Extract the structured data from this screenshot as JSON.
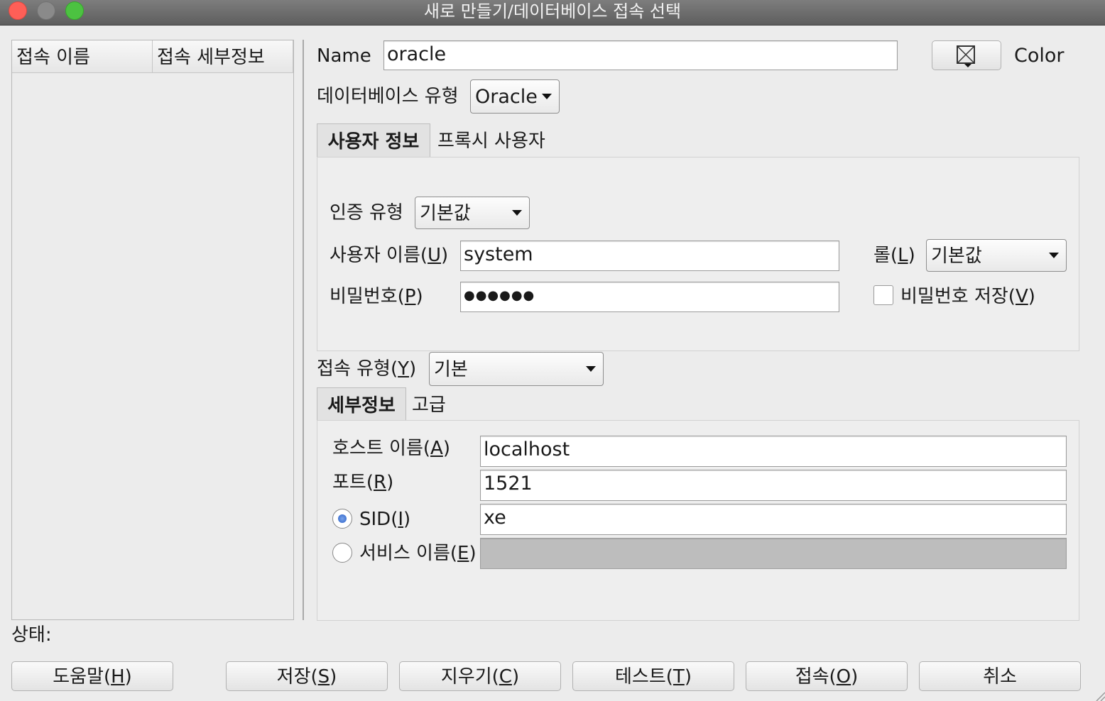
{
  "window": {
    "title": "새로 만들기/데이터베이스 접속 선택"
  },
  "connection_list": {
    "columns": [
      "접속 이름",
      "접속 세부정보"
    ]
  },
  "form": {
    "name_label": "Name",
    "name_value": "oracle",
    "color_label": "Color",
    "db_type_label": "데이터베이스 유형",
    "db_type_value": "Oracle",
    "user_tabs": [
      "사용자 정보",
      "프록시 사용자"
    ],
    "auth_type_label": "인증 유형",
    "auth_type_value": "기본값",
    "username_label": {
      "before": "사용자 이름(",
      "mnemonic": "U",
      "after": ")"
    },
    "username_value": "system",
    "role_label": {
      "before": "롤(",
      "mnemonic": "L",
      "after": ")"
    },
    "role_value": "기본값",
    "password_label": {
      "before": "비밀번호(",
      "mnemonic": "P",
      "after": ")"
    },
    "password_value": "●●●●●●",
    "save_password_label": {
      "before": "비밀번호 저장(",
      "mnemonic": "V",
      "after": ")"
    },
    "save_password_checked": false,
    "conn_type_label": {
      "before": "접속 유형(",
      "mnemonic": "Y",
      "after": ")"
    },
    "conn_type_value": "기본",
    "detail_tabs": [
      "세부정보",
      "고급"
    ],
    "host_label": {
      "before": "호스트 이름(",
      "mnemonic": "A",
      "after": ")"
    },
    "host_value": "localhost",
    "port_label": {
      "before": "포트(",
      "mnemonic": "R",
      "after": ")"
    },
    "port_value": "1521",
    "sid_label": {
      "before": "SID(",
      "mnemonic": "I",
      "after": ")"
    },
    "sid_value": "xe",
    "sid_selected": true,
    "service_label": {
      "before": "서비스 이름(",
      "mnemonic": "E",
      "after": ")"
    },
    "service_value": ""
  },
  "status": {
    "label": "상태:"
  },
  "buttons": {
    "help": {
      "before": "도움말(",
      "mnemonic": "H",
      "after": ")"
    },
    "save": {
      "before": "저장(",
      "mnemonic": "S",
      "after": ")"
    },
    "clear": {
      "before": "지우기(",
      "mnemonic": "C",
      "after": ")"
    },
    "test": {
      "before": "테스트(",
      "mnemonic": "T",
      "after": ")"
    },
    "connect": {
      "before": "접속(",
      "mnemonic": "O",
      "after": ")"
    },
    "cancel": "취소"
  },
  "icons": {
    "color_picker": "color-swatch-none-icon"
  }
}
